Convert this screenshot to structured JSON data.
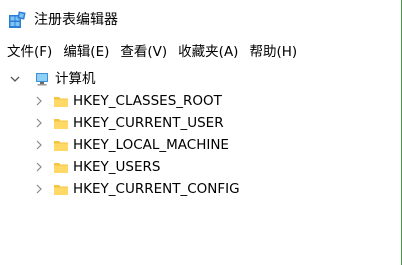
{
  "window": {
    "title": "注册表编辑器",
    "icon": "registry-editor-icon"
  },
  "menubar": {
    "items": [
      {
        "label": "文件(F)"
      },
      {
        "label": "编辑(E)"
      },
      {
        "label": "查看(V)"
      },
      {
        "label": "收藏夹(A)"
      },
      {
        "label": "帮助(H)"
      }
    ]
  },
  "tree": {
    "root": {
      "label": "计算机",
      "expanded": true,
      "icon": "computer-icon"
    },
    "children": [
      {
        "label": "HKEY_CLASSES_ROOT",
        "icon": "folder-icon"
      },
      {
        "label": "HKEY_CURRENT_USER",
        "icon": "folder-icon"
      },
      {
        "label": "HKEY_LOCAL_MACHINE",
        "icon": "folder-icon"
      },
      {
        "label": "HKEY_USERS",
        "icon": "folder-icon"
      },
      {
        "label": "HKEY_CURRENT_CONFIG",
        "icon": "folder-icon"
      }
    ]
  },
  "colors": {
    "folder": "#f5c542",
    "window_border": "#4a9a4a",
    "chevron": "#7a7a7a"
  }
}
